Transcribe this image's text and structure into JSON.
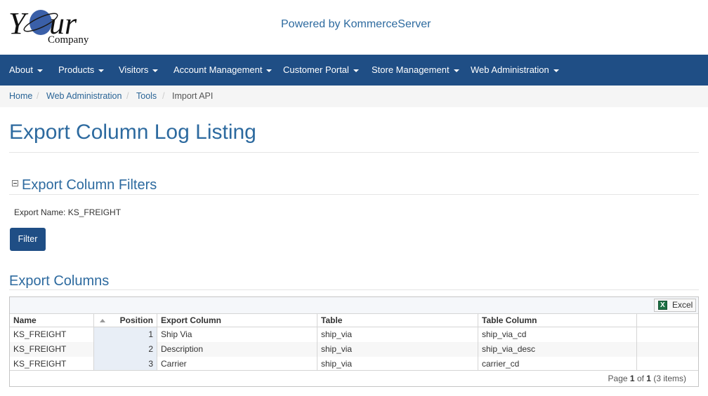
{
  "header": {
    "logo_main": "Your",
    "logo_sub": "Company",
    "powered_by": "Powered by KommerceServer"
  },
  "nav": {
    "items": [
      {
        "label": "About"
      },
      {
        "label": "Products"
      },
      {
        "label": "Visitors"
      },
      {
        "label": "Account Management"
      },
      {
        "label": "Customer Portal"
      },
      {
        "label": "Store Management"
      },
      {
        "label": "Web Administration"
      }
    ]
  },
  "breadcrumb": {
    "items": [
      "Home",
      "Web Administration",
      "Tools",
      "Import API"
    ],
    "separator": "/"
  },
  "page": {
    "title": "Export Column Log Listing"
  },
  "filters": {
    "title": "Export Column Filters",
    "export_name_label": "Export Name:",
    "export_name_value": "KS_FREIGHT",
    "filter_button": "Filter"
  },
  "grid": {
    "title": "Export Columns",
    "excel_button": "Excel",
    "columns": [
      "Name",
      "Position",
      "Export Column",
      "Table",
      "Table Column",
      ""
    ],
    "sorted_column": "Position",
    "rows": [
      {
        "name": "KS_FREIGHT",
        "position": "1",
        "export_column": "Ship Via",
        "table": "ship_via",
        "table_column": "ship_via_cd"
      },
      {
        "name": "KS_FREIGHT",
        "position": "2",
        "export_column": "Description",
        "table": "ship_via",
        "table_column": "ship_via_desc"
      },
      {
        "name": "KS_FREIGHT",
        "position": "3",
        "export_column": "Carrier",
        "table": "ship_via",
        "table_column": "carrier_cd"
      }
    ],
    "pager": {
      "prefix": "Page",
      "current": "1",
      "of": "of",
      "total": "1",
      "items": "(3 items)"
    }
  },
  "colors": {
    "navbar": "#1f4e85",
    "accent": "#2d6a9f",
    "breadcrumb_bg": "#f5f5f5"
  }
}
